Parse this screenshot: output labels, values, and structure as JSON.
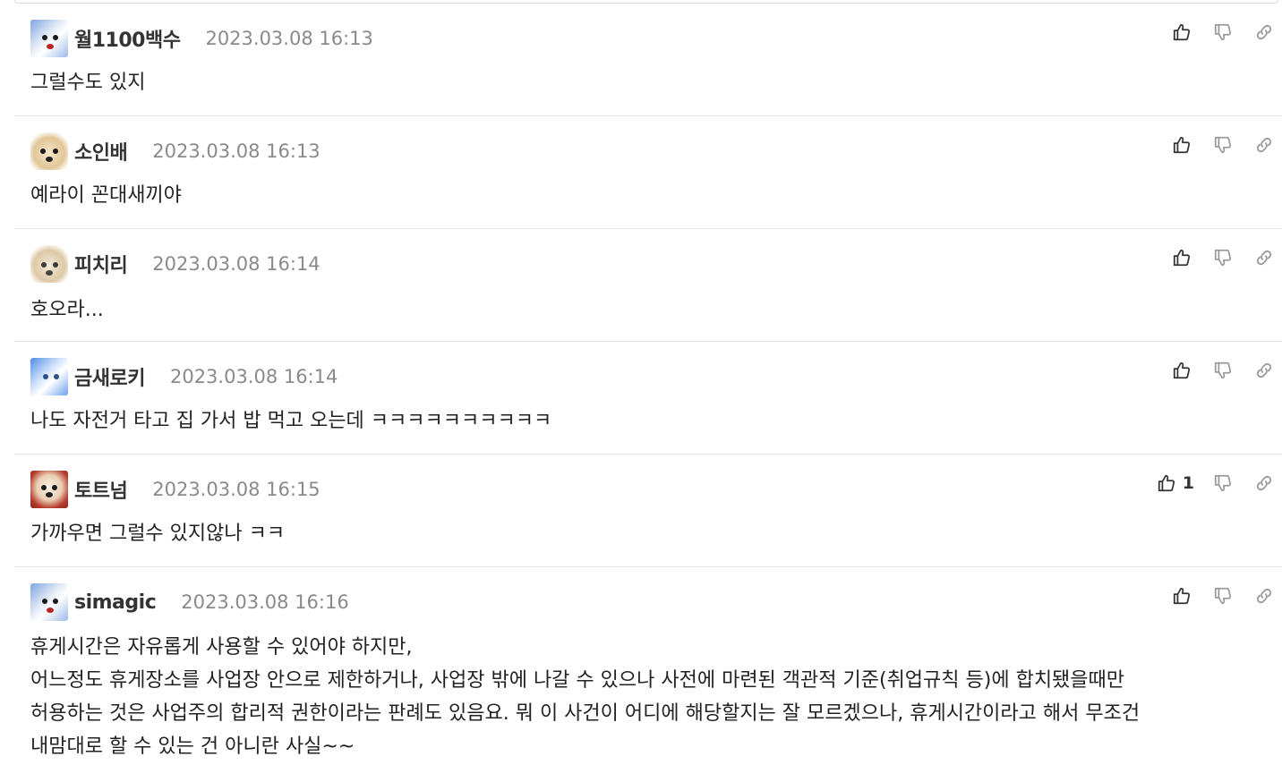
{
  "comments": [
    {
      "author": "월1100백수",
      "date": "2023.03.08 16:13",
      "text": "그럴수도 있지",
      "likes": "",
      "avatar": "white-dog-blue"
    },
    {
      "author": "소인배",
      "date": "2023.03.08 16:13",
      "text": "예라이 꼰대새끼야",
      "likes": "",
      "avatar": "puppy-tan"
    },
    {
      "author": "피치리",
      "date": "2023.03.08 16:14",
      "text": "호오라...",
      "likes": "",
      "avatar": "puppy-beige"
    },
    {
      "author": "금새로키",
      "date": "2023.03.08 16:14",
      "text": "나도 자전거 타고 집 가서 밥 먹고 오는데 ㅋㅋㅋㅋㅋㅋㅋㅋㅋㅋ",
      "likes": "",
      "avatar": "white-dog-sky"
    },
    {
      "author": "토트넘",
      "date": "2023.03.08 16:15",
      "text": "가까우면 그럴수 있지않나 ㅋㅋ",
      "likes": "1",
      "avatar": "dog-red-collar"
    },
    {
      "author": "simagic",
      "date": "2023.03.08 16:16",
      "text": "휴게시간은 자유롭게 사용할 수 있어야 하지만,\n어느정도 휴게장소를 사업장 안으로 제한하거나, 사업장 밖에 나갈 수 있으나 사전에 마련된 객관적 기준(취업규칙 등)에 합치됐을때만\n허용하는 것은 사업주의 합리적 권한이라는 판례도 있음요. 뭐 이 사건이 어디에 해당할지는 잘 모르겠으나, 휴게시간이라고 해서 무조건\n내맘대로 할 수 있는 건 아니란 사실~~",
      "likes": "",
      "avatar": "white-dog-blue"
    }
  ],
  "icons": {
    "like": "thumbs-up-icon",
    "dislike": "thumbs-down-icon",
    "link": "link-icon"
  },
  "colors": {
    "date": "#8a8a8a",
    "icon": "#333333",
    "icon_faded": "#9a9a9a",
    "divider": "#e6e6e6"
  }
}
